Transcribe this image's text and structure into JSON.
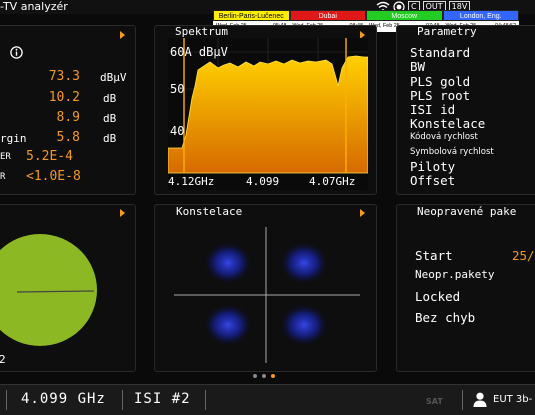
{
  "app": {
    "title": "-TV analyzér"
  },
  "status": {
    "c_label": "C",
    "out_label": "OUT",
    "voltage": "18V"
  },
  "clocks": [
    {
      "city": "Berlin-Paris-Lučenec",
      "date": "Wed, Feb 25",
      "time": "05:48",
      "bg": "#ffee00",
      "fg": "#000000"
    },
    {
      "city": "Dubai",
      "date": "Wed, Feb 25",
      "time": "08:48",
      "bg": "#e01818",
      "fg": "#ffffff"
    },
    {
      "city": "Moscow",
      "date": "Wed, Feb 25",
      "time": "07:48",
      "bg": "#22cc22",
      "fg": "#ffffff"
    },
    {
      "city": "London, Eng.",
      "date": "Wed, Feb 25",
      "time": "04:48:52",
      "bg": "#3366ff",
      "fg": "#ffffff"
    }
  ],
  "measurements": [
    {
      "label": "",
      "value": "73.3",
      "unit": "dBµV"
    },
    {
      "label": "",
      "value": "10.2",
      "unit": "dB"
    },
    {
      "label": "",
      "value": "8.9",
      "unit": "dB"
    },
    {
      "label": "rgin",
      "value": "5.8",
      "unit": "dB"
    },
    {
      "label": "ER",
      "value": "5.2E-4",
      "unit": ""
    },
    {
      "label": "R",
      "value": "<1.0E-8",
      "unit": ""
    }
  ],
  "spectrum": {
    "title": "Spektrum",
    "level_label": "60A dBµV",
    "y_ticks": [
      "50",
      "40"
    ],
    "x_ticks": [
      "4.12GHz",
      "4.099",
      "4.07GHz"
    ],
    "colors": {
      "fill_top": "#ffd000",
      "fill_bottom": "#e07800",
      "marker": "#ffb000"
    }
  },
  "parameters": {
    "title": "Parametry",
    "items": [
      {
        "label": "Standard",
        "size": "large"
      },
      {
        "label": "BW",
        "size": "large"
      },
      {
        "label": "PLS gold",
        "size": "large"
      },
      {
        "label": "PLS root",
        "size": "large"
      },
      {
        "label": "ISI id",
        "size": "large"
      },
      {
        "label": "Konstelace",
        "size": "large"
      },
      {
        "label": "Kódová rychlost",
        "size": "small"
      },
      {
        "label": "Symbolová rychlost",
        "size": "small"
      },
      {
        "label": "Piloty",
        "size": "large"
      },
      {
        "label": "Offset",
        "size": "large"
      }
    ]
  },
  "constellation": {
    "title": "Konstelace"
  },
  "uncorrected": {
    "title": "Neopravené pake",
    "start_label": "Start",
    "start_value": "25/",
    "rows": [
      "Neopr.pakety",
      "Locked",
      "Bez chyb"
    ]
  },
  "pie": {
    "color": "#8cb823",
    "bottom_glyph": "2"
  },
  "bottom": {
    "frequency": "4.099 GHz",
    "isi": "ISI #2",
    "sat_logo": "SAT",
    "user": "EUT 3b-"
  }
}
